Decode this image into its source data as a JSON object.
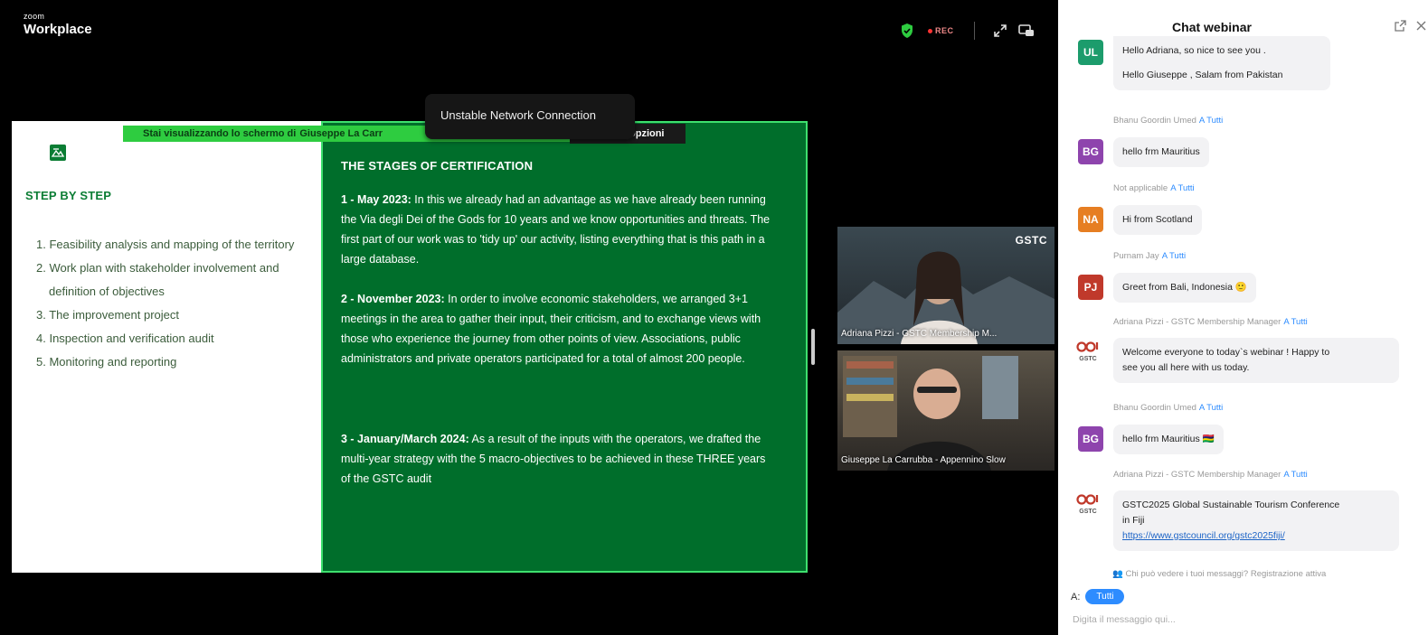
{
  "app": {
    "logo_small": "zoom",
    "logo_big": "Workplace",
    "rec_label": "REC"
  },
  "share": {
    "banner_text": "Stai visualizzando lo schermo di",
    "banner_name": "Giuseppe La Carr",
    "options_label": "opzioni",
    "network_tooltip": "Unstable Network Connection"
  },
  "slide": {
    "left_title": "STEP BY STEP",
    "steps": [
      "1. Feasibility analysis and mapping of the territory",
      "2. Work plan with stakeholder involvement and definition of objectives",
      "3. The improvement project",
      "4. Inspection and verification audit",
      "5. Monitoring and reporting"
    ],
    "right_title": "THE STAGES OF CERTIFICATION",
    "stages": [
      {
        "head": "1 - May 2023:",
        "body": " In this we already had an advantage as we have already been running the Via degli Dei of the Gods for 10 years and we know opportunities and threats. The first part of our work was to 'tidy up' our activity, listing everything that is this path in a large database."
      },
      {
        "head": "2 - November 2023:",
        "body": " In order to involve economic stakeholders, we arranged 3+1 meetings in the area to gather their input, their criticism, and to exchange views with those who experience the journey from other points of view. Associations, public administrators and private operators participated for a total of almost 200 people."
      },
      {
        "head": "3 - January/March 2024:",
        "body": " As a result of the inputs with the operators, we drafted the multi-year strategy with the 5 macro-objectives to be achieved in these THREE years of the GSTC audit"
      }
    ]
  },
  "videos": {
    "adriana_label": "Adriana Pizzi - GSTC Membership M...",
    "adriana_logo": "GSTC",
    "giuseppe_label": "Giuseppe La Carrubba - Appennino Slow"
  },
  "chat": {
    "title": "Chat webinar",
    "messages": [
      {
        "avatar": "UL",
        "color": "#1c9c6c",
        "sender": "",
        "to": "",
        "lines": [
          "Hello Adriana, so nice to see you .",
          "",
          "Hello Giuseppe , Salam from Pakistan"
        ]
      },
      {
        "avatar": "BG",
        "color": "#8e44ad",
        "sender": "Bhanu Goordin Umed",
        "to": "A Tutti",
        "lines": [
          "hello frm Mauritius"
        ]
      },
      {
        "avatar": "NA",
        "color": "#e67e22",
        "sender": "Not applicable",
        "to": "A Tutti",
        "lines": [
          "Hi from Scotland"
        ]
      },
      {
        "avatar": "PJ",
        "color": "#c0392b",
        "sender": "Purnam Jay",
        "to": "A Tutti",
        "lines": [
          "Greet from Bali, Indonesia 🙂"
        ]
      },
      {
        "avatar": "GSTC",
        "color": "",
        "sender": "Adriana Pizzi - GSTC Membership Manager",
        "to": "A Tutti",
        "lines": [
          "Welcome everyone to today`s webinar ! Happy to",
          "see you all here with us today."
        ]
      },
      {
        "avatar": "BG",
        "color": "#8e44ad",
        "sender": "Bhanu Goordin Umed",
        "to": "A Tutti",
        "lines": [
          "hello frm Mauritius 🇲🇺"
        ]
      },
      {
        "avatar": "GSTC",
        "color": "",
        "sender": "Adriana Pizzi - GSTC Membership Manager",
        "to": "A Tutti",
        "lines": [
          "GSTC2025 Global Sustainable Tourism Conference",
          "in Fiji"
        ],
        "link": "https://www.gstcouncil.org/gstc2025fiji/"
      }
    ],
    "privacy_note": "Chi può vedere i tuoi messaggi? Registrazione attiva",
    "to_label": "A:",
    "to_chip": "Tutti",
    "input_placeholder": "Digita il messaggio qui..."
  }
}
